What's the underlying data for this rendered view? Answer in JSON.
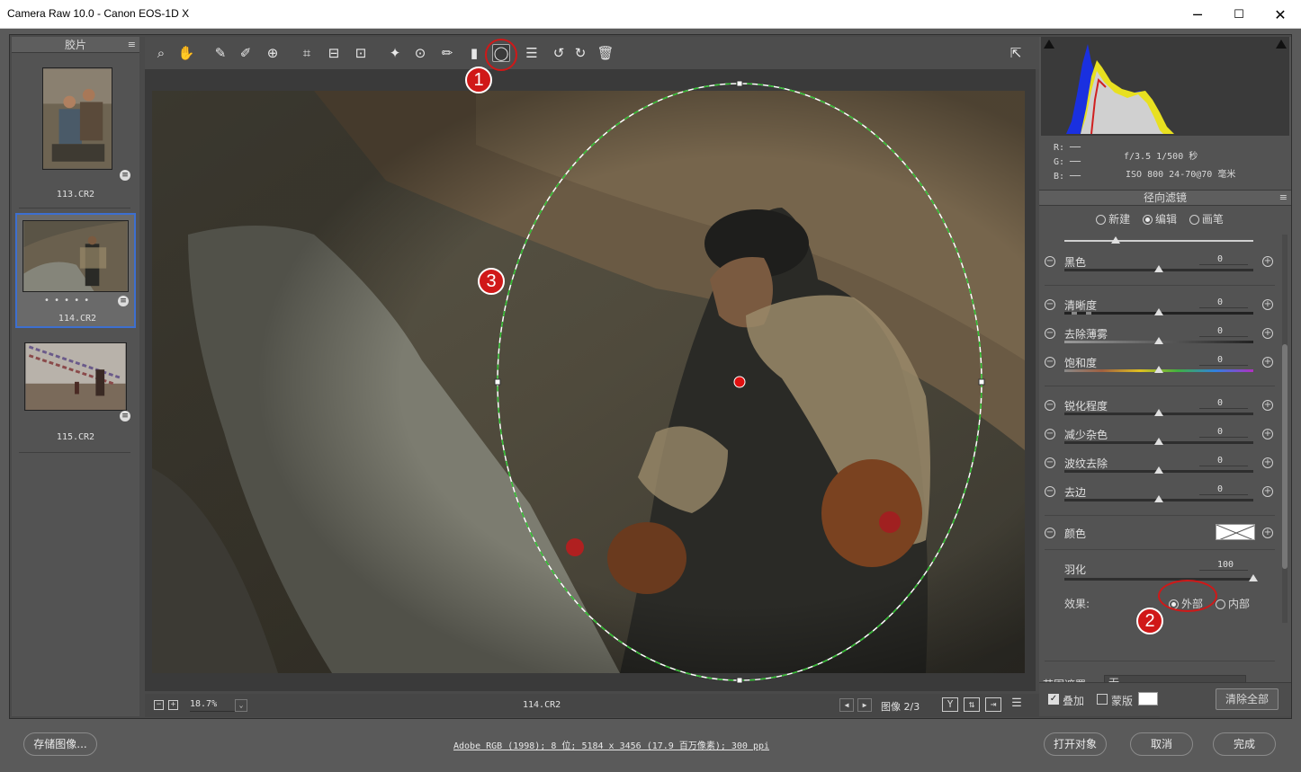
{
  "window": {
    "title": "Camera Raw 10.0 -  Canon EOS-1D X",
    "minimize": "─",
    "maximize": "☐",
    "close": "✕"
  },
  "filmstrip": {
    "header": "胶片",
    "items": [
      {
        "name": "113.CR2"
      },
      {
        "name": "114.CR2",
        "rating": "• • • • •"
      },
      {
        "name": "115.CR2"
      }
    ]
  },
  "toolbar": {
    "tools": [
      "zoom-icon",
      "hand-icon",
      "white-balance-icon",
      "color-sampler-icon",
      "target-adjust-icon",
      "crop-icon",
      "straighten-icon",
      "transform-icon",
      "spot-removal-icon",
      "red-eye-icon",
      "adjustment-brush-icon",
      "graduated-filter-icon",
      "radial-filter-icon",
      "preferences-icon",
      "rotate-ccw-icon",
      "rotate-cw-icon",
      "trash-icon"
    ]
  },
  "status": {
    "zoom": "18.7%",
    "filename": "114.CR2",
    "image_counter": "图像 2/3"
  },
  "histogram": {
    "r": "R:",
    "g": "G:",
    "b": "B:",
    "dash": "──",
    "exposure1": "f/3.5   1/500 秒",
    "exposure2": "ISO 800   24-70@70 毫米"
  },
  "panel": {
    "title": "径向滤镜",
    "modes": [
      {
        "label": "新建",
        "on": false
      },
      {
        "label": "编辑",
        "on": true
      },
      {
        "label": "画笔",
        "on": false
      }
    ],
    "sliders": [
      {
        "label": "黑色",
        "value": "0"
      },
      {
        "label": "清晰度",
        "value": "0"
      },
      {
        "label": "去除薄雾",
        "value": "0"
      },
      {
        "label": "饱和度",
        "value": "0"
      },
      {
        "label": "锐化程度",
        "value": "0"
      },
      {
        "label": "减少杂色",
        "value": "0"
      },
      {
        "label": "波纹去除",
        "value": "0"
      },
      {
        "label": "去边",
        "value": "0"
      }
    ],
    "color_label": "颜色",
    "feather_label": "羽化",
    "feather_value": "100",
    "effect_label": "效果:",
    "effect_outside": "外部",
    "effect_inside": "内部",
    "range_mask_label": "范围遮罩:",
    "range_mask_value": "无",
    "overlay_label": "叠加",
    "mask_label": "蒙版",
    "clear_all": "清除全部"
  },
  "footer": {
    "save": "存储图像...",
    "workflow": "Adobe RGB (1998); 8 位; 5184 x 3456 (17.9 百万像素); 300 ppi",
    "open": "打开对象",
    "cancel": "取消",
    "done": "完成"
  },
  "annotations": [
    "1",
    "2",
    "3"
  ],
  "colors": {
    "accent": "#3d6fd0",
    "annotation": "#d01818",
    "overlay_green": "#2fbf2f"
  }
}
